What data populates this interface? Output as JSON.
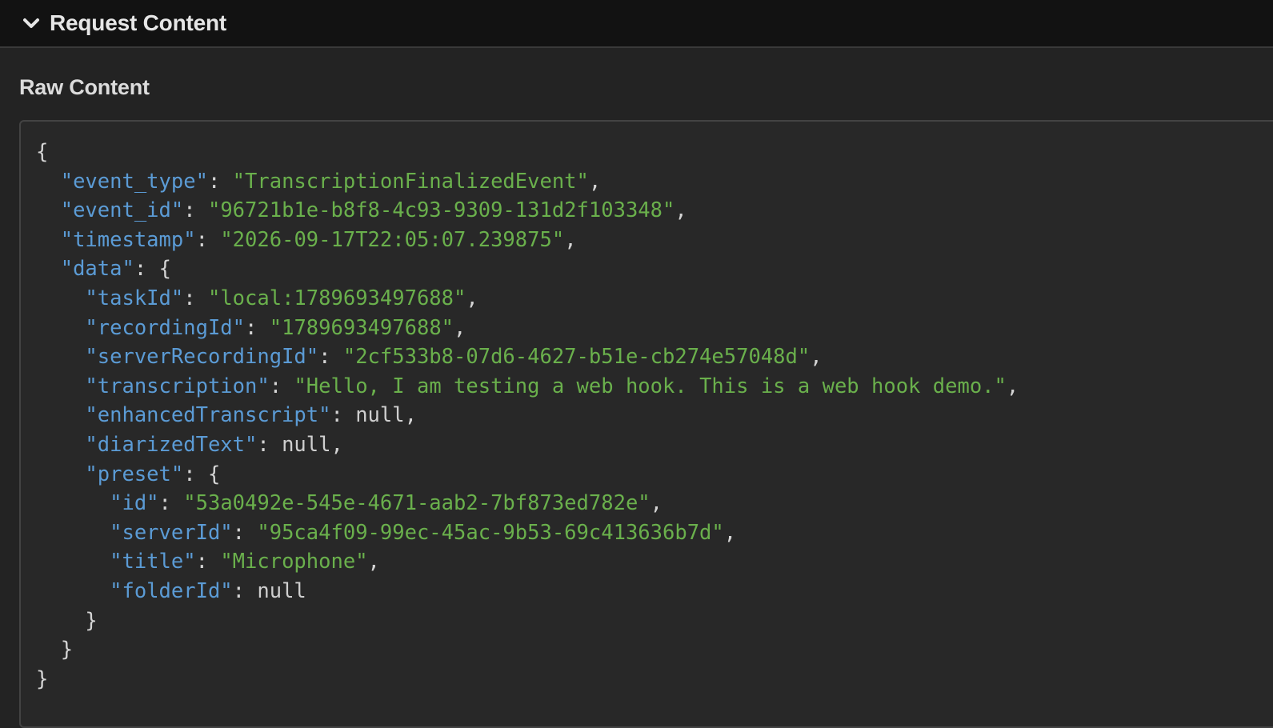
{
  "header": {
    "title": "Request Content",
    "toggle_icon": "chevron-down-icon"
  },
  "section": {
    "title": "Raw Content"
  },
  "colors": {
    "key": "#5b9bd5",
    "string": "#6ab04c",
    "null": "#cfcfcf",
    "punctuation": "#d4d4d4",
    "header_bg": "#121212",
    "panel_bg": "#232323",
    "code_bg": "#282828"
  },
  "raw_content": {
    "event_type": "TranscriptionFinalizedEvent",
    "event_id": "96721b1e-b8f8-4c93-9309-131d2f103348",
    "timestamp": "2026-09-17T22:05:07.239875",
    "data": {
      "taskId": "local:1789693497688",
      "recordingId": "1789693497688",
      "serverRecordingId": "2cf533b8-07d6-4627-b51e-cb274e57048d",
      "transcription": "Hello, I am testing a web hook. This is a web hook demo.",
      "enhancedTranscript": null,
      "diarizedText": null,
      "preset": {
        "id": "53a0492e-545e-4671-aab2-7bf873ed782e",
        "serverId": "95ca4f09-99ec-45ac-9b53-69c413636b7d",
        "title": "Microphone",
        "folderId": null
      }
    }
  }
}
